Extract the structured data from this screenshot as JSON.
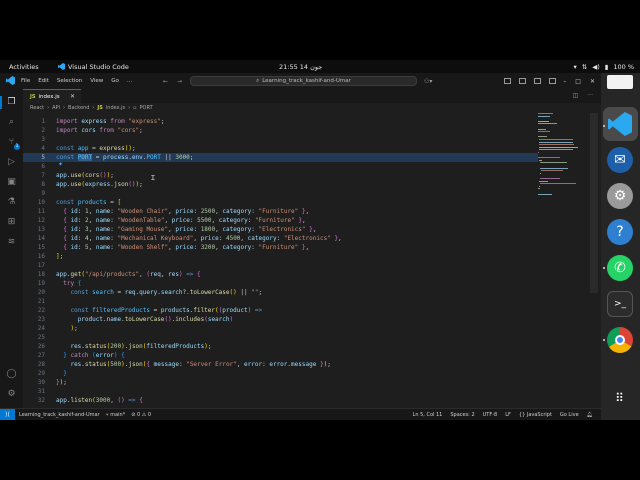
{
  "system_bar": {
    "activities": "Activities",
    "app_name": "Visual Studio Code",
    "clock": "21:55 14 جون",
    "battery": "100 %"
  },
  "titlebar": {
    "menu": [
      "File",
      "Edit",
      "Selection",
      "View",
      "Go",
      "..."
    ],
    "command_center": "Learning_track_kashif-and-Umar"
  },
  "activity_badge": "1",
  "tab": {
    "label": "index.js",
    "icon": "JS"
  },
  "breadcrumb": [
    "React",
    "API",
    "Backend",
    "index.js",
    "PORT"
  ],
  "code_lines": [
    {
      "n": "1",
      "html": "<span class='k'>import</span> <span class='v'>express</span> <span class='k'>from</span> <span class='s'>\"express\"</span><span class='p'>;</span>"
    },
    {
      "n": "2",
      "html": "<span class='k'>import</span> <span class='v'>cors</span> <span class='k'>from</span> <span class='s'>\"cors\"</span><span class='p'>;</span>"
    },
    {
      "n": "3",
      "html": ""
    },
    {
      "n": "4",
      "html": "<span class='k2'>const</span> <span class='c'>app</span> <span class='p'>=</span> <span class='f'>express</span><span class='b1'>()</span><span class='p'>;</span>"
    },
    {
      "n": "5",
      "hl": true,
      "html": "<span class='k2'>const</span> <span class='c sel'>PORT</span> <span class='p'>=</span> <span class='v'>process</span><span class='p'>.</span><span class='v'>env</span><span class='p'>.</span><span class='c'>PORT</span> <span class='p'>||</span> <span class='n'>3000</span><span class='p'>;</span>"
    },
    {
      "n": "6",
      "html": ""
    },
    {
      "n": "7",
      "html": "<span class='v'>app</span><span class='p'>.</span><span class='f'>use</span><span class='b1'>(</span><span class='f'>cors</span><span class='b2'>()</span><span class='b1'>)</span><span class='p'>;</span>"
    },
    {
      "n": "8",
      "html": "<span class='v'>app</span><span class='p'>.</span><span class='f'>use</span><span class='b1'>(</span><span class='v'>express</span><span class='p'>.</span><span class='f'>json</span><span class='b2'>()</span><span class='b1'>)</span><span class='p'>;</span>"
    },
    {
      "n": "9",
      "html": ""
    },
    {
      "n": "10",
      "html": "<span class='k2'>const</span> <span class='c'>products</span> <span class='p'>=</span> <span class='b1'>[</span>"
    },
    {
      "n": "11",
      "html": "  <span class='b2'>{</span> <span class='v'>id</span><span class='p'>:</span> <span class='n'>1</span><span class='p'>,</span> <span class='v'>name</span><span class='p'>:</span> <span class='s'>\"Wooden Chair\"</span><span class='p'>,</span> <span class='v'>price</span><span class='p'>:</span> <span class='n'>2500</span><span class='p'>,</span> <span class='v'>category</span><span class='p'>:</span> <span class='s'>\"Furniture\"</span> <span class='b2'>}</span><span class='p'>,</span>"
    },
    {
      "n": "12",
      "html": "  <span class='b2'>{</span> <span class='v'>id</span><span class='p'>:</span> <span class='n'>2</span><span class='p'>,</span> <span class='v'>name</span><span class='p'>:</span> <span class='s'>\"WoodenTable\"</span><span class='p'>,</span> <span class='v'>price</span><span class='p'>:</span> <span class='n'>5500</span><span class='p'>,</span> <span class='v'>category</span><span class='p'>:</span> <span class='s'>\"Furniture\"</span> <span class='b2'>}</span><span class='p'>,</span>"
    },
    {
      "n": "13",
      "html": "  <span class='b2'>{</span> <span class='v'>id</span><span class='p'>:</span> <span class='n'>3</span><span class='p'>,</span> <span class='v'>name</span><span class='p'>:</span> <span class='s'>\"Gaming Mouse\"</span><span class='p'>,</span> <span class='v'>price</span><span class='p'>:</span> <span class='n'>1800</span><span class='p'>,</span> <span class='v'>category</span><span class='p'>:</span> <span class='s'>\"Electronics\"</span> <span class='b2'>}</span><span class='p'>,</span>"
    },
    {
      "n": "14",
      "html": "  <span class='b2'>{</span> <span class='v'>id</span><span class='p'>:</span> <span class='n'>4</span><span class='p'>,</span> <span class='v'>name</span><span class='p'>:</span> <span class='s'>\"Mechanical Keyboard\"</span><span class='p'>,</span> <span class='v'>price</span><span class='p'>:</span> <span class='n'>4500</span><span class='p'>,</span> <span class='v'>category</span><span class='p'>:</span> <span class='s'>\"Electronics\"</span> <span class='b2'>}</span><span class='p'>,</span>"
    },
    {
      "n": "15",
      "html": "  <span class='b2'>{</span> <span class='v'>id</span><span class='p'>:</span> <span class='n'>5</span><span class='p'>,</span> <span class='v'>name</span><span class='p'>:</span> <span class='s'>\"Wooden Shelf\"</span><span class='p'>,</span> <span class='v'>price</span><span class='p'>:</span> <span class='n'>3200</span><span class='p'>,</span> <span class='v'>category</span><span class='p'>:</span> <span class='s'>\"Furniture\"</span> <span class='b2'>}</span><span class='p'>,</span>"
    },
    {
      "n": "16",
      "html": "<span class='b1'>]</span><span class='p'>;</span>"
    },
    {
      "n": "17",
      "html": ""
    },
    {
      "n": "18",
      "html": "<span class='v'>app</span><span class='p'>.</span><span class='f'>get</span><span class='b1'>(</span><span class='s'>\"/api/products\"</span><span class='p'>,</span> <span class='b2'>(</span><span class='v'>req</span><span class='p'>,</span> <span class='v'>res</span><span class='b2'>)</span> <span class='k2'>=&gt;</span> <span class='b2'>{</span>"
    },
    {
      "n": "19",
      "html": "  <span class='k'>try</span> <span class='b3'>{</span>"
    },
    {
      "n": "20",
      "html": "    <span class='k2'>const</span> <span class='c'>search</span> <span class='p'>=</span> <span class='v'>req</span><span class='p'>.</span><span class='v'>query</span><span class='p'>.</span><span class='v'>search</span><span class='p'>?.</span><span class='f'>toLowerCase</span><span class='b1'>()</span> <span class='p'>||</span> <span class='s'>\"\"</span><span class='p'>;</span>"
    },
    {
      "n": "21",
      "html": ""
    },
    {
      "n": "22",
      "html": "    <span class='k2'>const</span> <span class='c'>filteredProducts</span> <span class='p'>=</span> <span class='v'>products</span><span class='p'>.</span><span class='f'>filter</span><span class='b1'>(</span><span class='b2'>(</span><span class='v'>product</span><span class='b2'>)</span> <span class='k2'>=&gt;</span>"
    },
    {
      "n": "23",
      "html": "      <span class='v'>product</span><span class='p'>.</span><span class='v'>name</span><span class='p'>.</span><span class='f'>toLowerCase</span><span class='b2'>()</span><span class='p'>.</span><span class='f'>includes</span><span class='b2'>(</span><span class='v'>search</span><span class='b2'>)</span>"
    },
    {
      "n": "24",
      "html": "    <span class='b1'>)</span><span class='p'>;</span>"
    },
    {
      "n": "25",
      "html": ""
    },
    {
      "n": "26",
      "html": "    <span class='v'>res</span><span class='p'>.</span><span class='f'>status</span><span class='b1'>(</span><span class='n'>200</span><span class='b1'>)</span><span class='p'>.</span><span class='f'>json</span><span class='b1'>(</span><span class='v'>filteredProducts</span><span class='b1'>)</span><span class='p'>;</span>"
    },
    {
      "n": "27",
      "html": "  <span class='b3'>}</span> <span class='k'>catch</span> <span class='b3'>(</span><span class='v'>error</span><span class='b3'>)</span> <span class='b3'>{</span>"
    },
    {
      "n": "28",
      "html": "    <span class='v'>res</span><span class='p'>.</span><span class='f'>status</span><span class='b1'>(</span><span class='n'>500</span><span class='b1'>)</span><span class='p'>.</span><span class='f'>json</span><span class='b1'>(</span><span class='b2'>{</span> <span class='v'>message</span><span class='p'>:</span> <span class='s'>\"Server Error\"</span><span class='p'>,</span> <span class='v'>error</span><span class='p'>:</span> <span class='v'>error</span><span class='p'>.</span><span class='v'>message</span> <span class='b2'>}</span><span class='b1'>)</span><span class='p'>;</span>"
    },
    {
      "n": "29",
      "html": "  <span class='b3'>}</span>"
    },
    {
      "n": "30",
      "html": "<span class='b2'>}</span><span class='b1'>)</span><span class='p'>;</span>"
    },
    {
      "n": "31",
      "html": ""
    },
    {
      "n": "32",
      "html": "<span class='v'>app</span><span class='p'>.</span><span class='f'>listen</span><span class='b1'>(</span><span class='n'>3000</span><span class='p'>,</span> <span class='b2'>()</span> <span class='k2'>=&gt;</span> <span class='b2'>{</span>"
    }
  ],
  "statusbar": {
    "left": [
      "Learning_track_kashif-and-Umar",
      "main*",
      "⊘ 0  ⚠ 0"
    ],
    "right": [
      "Ln 5, Col 11",
      "Spaces: 2",
      "UTF-8",
      "LF",
      "{} JavaScript",
      "Go Live"
    ]
  },
  "colors": {
    "accent": "#0078d4",
    "editor_bg": "#1e1e1e",
    "line_highlight": "#233a57"
  }
}
